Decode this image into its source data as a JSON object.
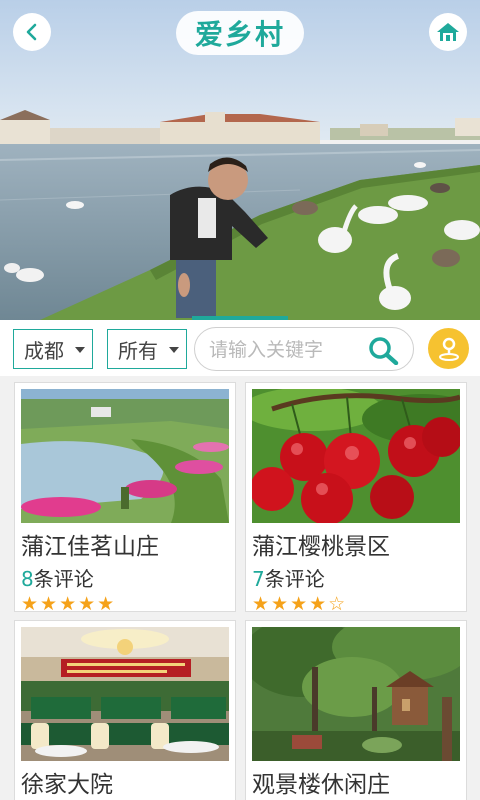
{
  "header": {
    "title": "爱乡村",
    "back_icon": "back-arrow-icon",
    "home_icon": "home-icon",
    "accent_color": "#1fa99b"
  },
  "filters": {
    "city": "成都",
    "category": "所有",
    "search_placeholder": "请输入关键字",
    "search_icon": "search-icon",
    "scan_icon": "map-pin-icon"
  },
  "places": [
    {
      "name": "蒲江佳茗山庄",
      "review_count": "8",
      "review_suffix": "条评论",
      "rating": 5,
      "stars": "★★★★★"
    },
    {
      "name": "蒲江樱桃景区",
      "review_count": "7",
      "review_suffix": "条评论",
      "rating": 4,
      "stars": "★★★★☆"
    },
    {
      "name": "徐家大院"
    },
    {
      "name": "观景楼休闲庄"
    }
  ]
}
